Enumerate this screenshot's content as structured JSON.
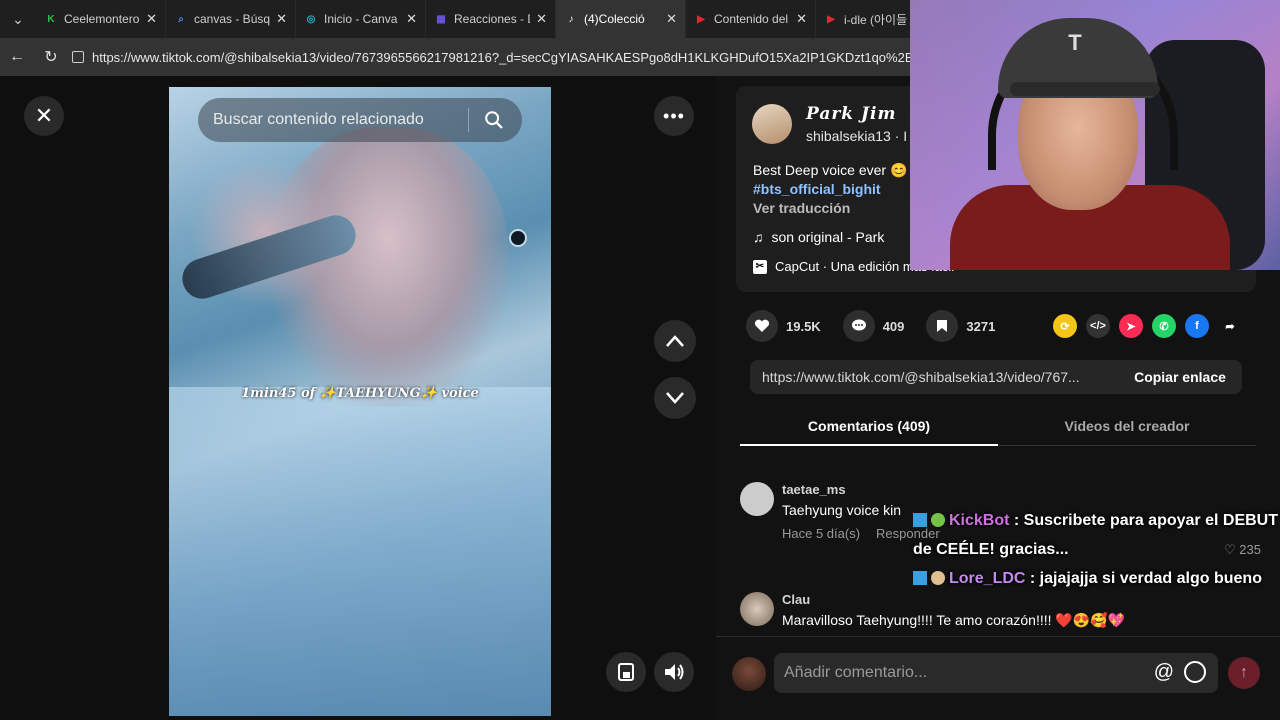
{
  "browser": {
    "tabs": [
      {
        "label": "Ceelemontero",
        "color": "#2cbf4a",
        "glyph": "K"
      },
      {
        "label": "canvas - Búsqu",
        "color": "#4a8af4",
        "glyph": "⌕"
      },
      {
        "label": "Inicio - Canva",
        "color": "#1fb8c8",
        "glyph": "◎"
      },
      {
        "label": "Reacciones - D",
        "color": "#6b5bd6",
        "glyph": "▦"
      },
      {
        "label": "(4)Colecció",
        "color": "#ffffff",
        "glyph": "♪",
        "active": true
      },
      {
        "label": "Contenido del",
        "color": "#e0282e",
        "glyph": "▶"
      },
      {
        "label": "i-dle (아이들",
        "color": "#e0282e",
        "glyph": "▶"
      }
    ],
    "url": "https://www.tiktok.com/@shibalsekia13/video/7673965566217981216?_d=secCgYIASAHKAESPgo8dH1KLKGHDufO15Xa2IP1GKDzt1qo%2Be"
  },
  "video": {
    "search_placeholder": "Buscar contenido relacionado",
    "overlay_text": "1min45 of ✨TAEHYUNG✨ voice"
  },
  "creator": {
    "display_name": "Park Jim",
    "handle": "shibalsekia13 · I",
    "description": "Best Deep voice ever 😊",
    "hashtag": "#bts_official_bighit",
    "translate": "Ver traducción",
    "music": "son original - Park",
    "capcut": "CapCut · Una edición más fácil"
  },
  "actions": {
    "likes": "19.5K",
    "comments": "409",
    "saves": "3271"
  },
  "link": {
    "url": "https://www.tiktok.com/@shibalsekia13/video/767...",
    "copy_label": "Copiar enlace"
  },
  "tabs": {
    "comments": "Comentarios (409)",
    "creator_videos": "Videos del creador"
  },
  "comments": [
    {
      "user": "taetae_ms",
      "text": "Taehyung voice kin",
      "time": "Hace 5 día(s)",
      "reply": "Responder",
      "likes": "235"
    },
    {
      "user": "Clau",
      "text": "Maravilloso Taehyung!!!! Te amo corazón!!!! ❤️😍🥰💖"
    }
  ],
  "add_comment": {
    "placeholder": "Añadir comentario..."
  },
  "chat": [
    {
      "user": "KickBot",
      "message": ": Suscribete para apoyar el DEBUT de CEÉLE! gracias..."
    },
    {
      "user": "Lore_LDC",
      "message": ": jajajajja si verdad algo bueno"
    }
  ]
}
